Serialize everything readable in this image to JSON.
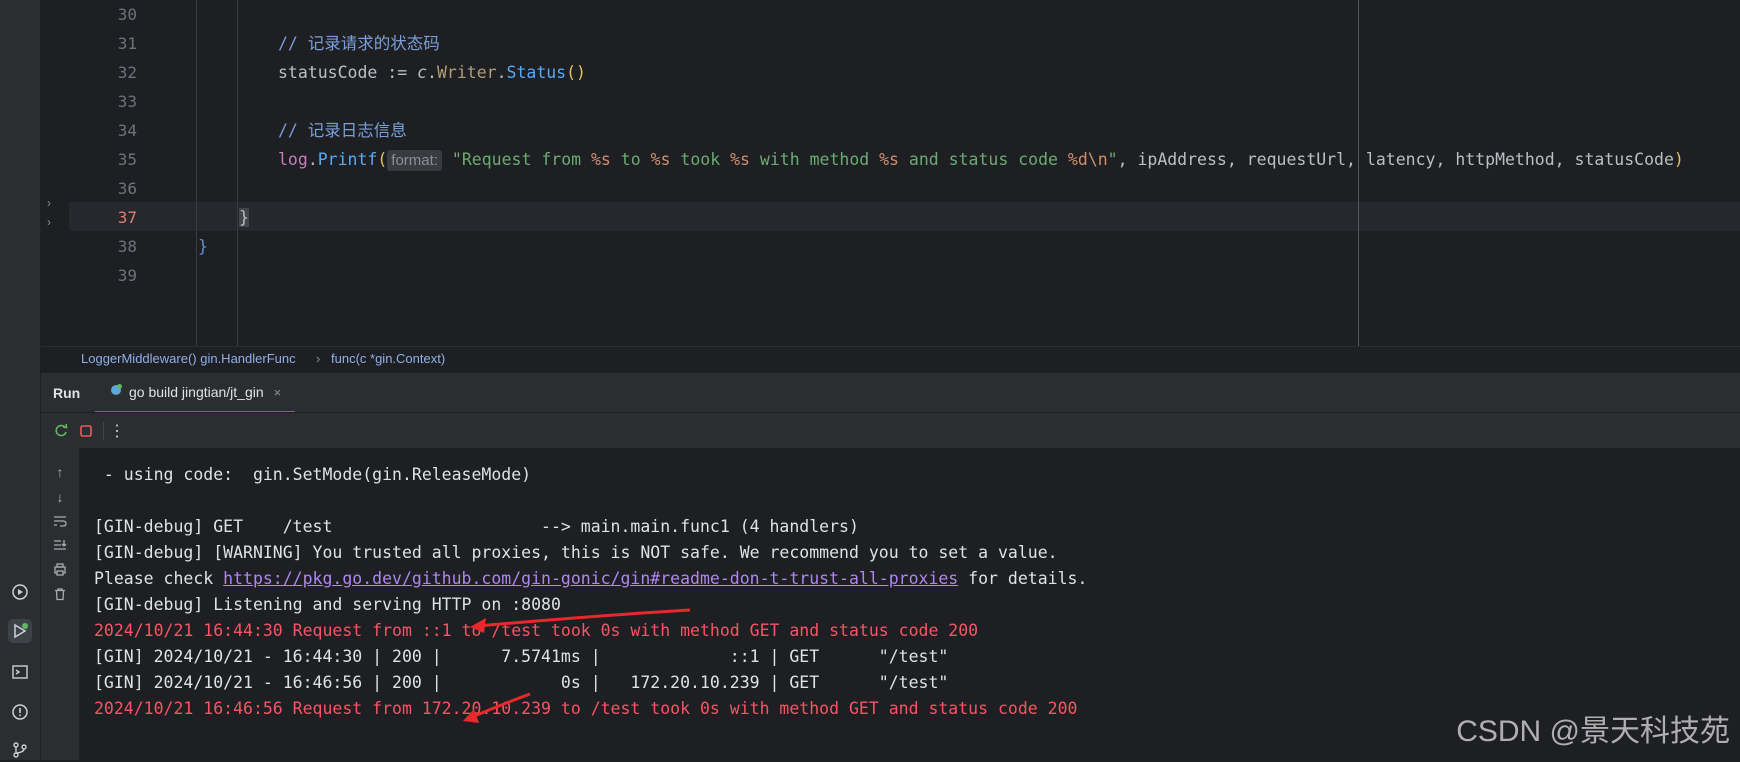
{
  "editor": {
    "lines": [
      {
        "num": "30",
        "tokens": []
      },
      {
        "num": "31",
        "tokens": [
          {
            "t": "// 记录请求的状态码",
            "c": "c-comment"
          }
        ]
      },
      {
        "num": "32",
        "tokens": [
          {
            "t": "statusCode",
            "c": "c-id"
          },
          {
            "t": " := ",
            "c": "c-id"
          },
          {
            "t": "c",
            "c": "c-param"
          },
          {
            "t": ".",
            "c": "c-id"
          },
          {
            "t": "Writer",
            "c": "c-method"
          },
          {
            "t": ".",
            "c": "c-id"
          },
          {
            "t": "Status",
            "c": "c-fn"
          },
          {
            "t": "()",
            "c": "c-brace"
          }
        ]
      },
      {
        "num": "33",
        "tokens": []
      },
      {
        "num": "34",
        "tokens": [
          {
            "t": "// 记录日志信息",
            "c": "c-comment"
          }
        ]
      },
      {
        "num": "35",
        "tokens": [
          {
            "t": "log",
            "c": "c-type"
          },
          {
            "t": ".",
            "c": "c-id"
          },
          {
            "t": "Printf",
            "c": "c-fn"
          },
          {
            "t": "(",
            "c": "c-brace"
          },
          {
            "t": "format:",
            "c": "hint"
          },
          {
            "t": " \"Request from ",
            "c": "c-str"
          },
          {
            "t": "%s",
            "c": "c-esc"
          },
          {
            "t": " to ",
            "c": "c-str"
          },
          {
            "t": "%s",
            "c": "c-esc"
          },
          {
            "t": " took ",
            "c": "c-str"
          },
          {
            "t": "%s",
            "c": "c-esc"
          },
          {
            "t": " with method ",
            "c": "c-str"
          },
          {
            "t": "%s",
            "c": "c-esc"
          },
          {
            "t": " and status code ",
            "c": "c-str"
          },
          {
            "t": "%d\\n",
            "c": "c-esc"
          },
          {
            "t": "\"",
            "c": "c-str"
          },
          {
            "t": ", ipAddress, requestUrl, latency, httpMethod, statusCode",
            "c": "c-id"
          },
          {
            "t": ")",
            "c": "c-brace"
          }
        ]
      },
      {
        "num": "36",
        "tokens": []
      },
      {
        "num": "37",
        "tokens": [
          {
            "t": "}",
            "c": "c-id"
          }
        ],
        "current": true
      },
      {
        "num": "38",
        "tokens": [
          {
            "t": "}",
            "c": "c-blue"
          }
        ]
      },
      {
        "num": "39",
        "tokens": []
      }
    ]
  },
  "breadcrumb": {
    "items": [
      "LoggerMiddleware() gin.HandlerFunc",
      "›",
      "func(c *gin.Context)"
    ]
  },
  "run": {
    "label": "Run",
    "tab_title": "go build jingtian/jt_gin",
    "tab_close": "×"
  },
  "console": {
    "lines": [
      {
        "text": " - using code:  gin.SetMode(gin.ReleaseMode)",
        "color": "normal"
      },
      {
        "text": "",
        "color": "normal"
      },
      {
        "text": "[GIN-debug] GET    /test                     --> main.main.func1 (4 handlers)",
        "color": "normal"
      },
      {
        "text": "[GIN-debug] [WARNING] You trusted all proxies, this is NOT safe. We recommend you to set a value.",
        "color": "normal"
      },
      {
        "text": "Please check ",
        "link": "https://pkg.go.dev/github.com/gin-gonic/gin#readme-don-t-trust-all-proxies",
        "after": " for details.",
        "color": "normal"
      },
      {
        "text": "[GIN-debug] Listening and serving HTTP on :8080",
        "color": "normal"
      },
      {
        "text": "2024/10/21 16:44:30 Request from ::1 to /test took 0s with method GET and status code 200",
        "color": "red"
      },
      {
        "text": "[GIN] 2024/10/21 - 16:44:30 | 200 |      7.5741ms |             ::1 | GET      \"/test\"",
        "color": "normal"
      },
      {
        "text": "[GIN] 2024/10/21 - 16:46:56 | 200 |            0s |   172.20.10.239 | GET      \"/test\"",
        "color": "normal"
      },
      {
        "text": "2024/10/21 16:46:56 Request from 172.20.10.239 to /test took 0s with method GET and status code 200",
        "color": "red"
      }
    ]
  },
  "watermark": "CSDN @景天科技苑",
  "colors": {
    "accent": "#3574f0",
    "error_text": "#f75464",
    "arrow": "#e8282a"
  }
}
